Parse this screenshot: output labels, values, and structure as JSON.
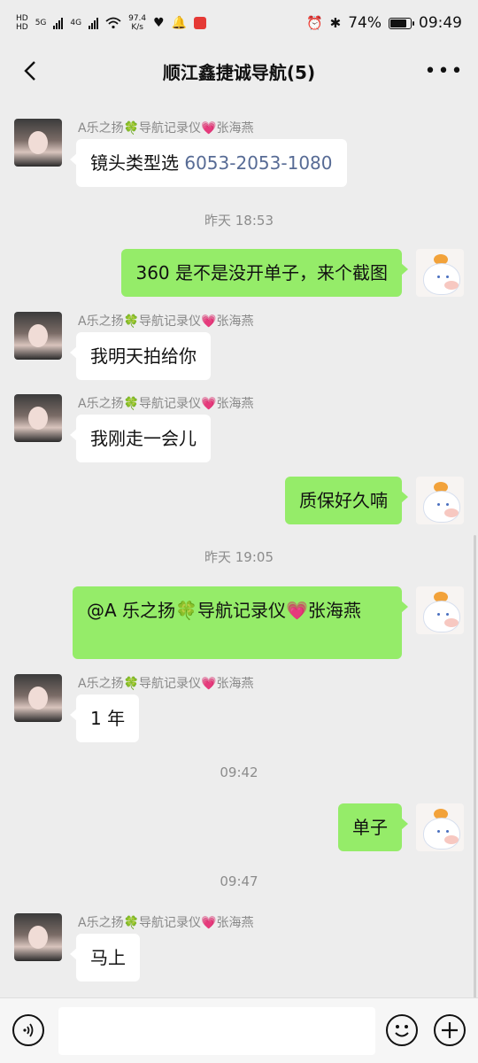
{
  "status_bar": {
    "net1": "HD",
    "sim1": "5G",
    "net2": "HD",
    "sim2": "4G",
    "speed_value": "97.4",
    "speed_unit": "K/s",
    "battery": "74%",
    "time": "09:49"
  },
  "header": {
    "title": "顺江鑫捷诚导航(5)",
    "back_icon": "chevron-left-icon",
    "more_icon": "more-icon"
  },
  "messages": [
    {
      "sender": "A乐之扬🍀导航记录仪💗张海燕",
      "text_prefix": "镜头类型选 ",
      "text_number": "6053-2053-1080"
    },
    {
      "time": "昨天 18:53"
    },
    {
      "text": "360 是不是没开单子，来个截图"
    },
    {
      "sender": "A乐之扬🍀导航记录仪💗张海燕",
      "text": "我明天拍给你"
    },
    {
      "sender": "A乐之扬🍀导航记录仪💗张海燕",
      "text": "我刚走一会儿"
    },
    {
      "text": "质保好久喃"
    },
    {
      "time": "昨天 19:05"
    },
    {
      "text": "@A 乐之扬🍀导航记录仪💗张海燕"
    },
    {
      "sender": "A乐之扬🍀导航记录仪💗张海燕",
      "text": "1 年"
    },
    {
      "time": "09:42"
    },
    {
      "text": "单子"
    },
    {
      "time": "09:47"
    },
    {
      "sender": "A乐之扬🍀导航记录仪💗张海燕",
      "text": "马上"
    }
  ],
  "bottom": {
    "voice_icon": "voice-icon",
    "emoji_icon": "emoji-icon",
    "plus_icon": "plus-icon",
    "input_value": ""
  },
  "colors": {
    "background": "#ededed",
    "self_bubble": "#95ec69",
    "other_bubble": "#ffffff",
    "link_number": "#576b95"
  }
}
